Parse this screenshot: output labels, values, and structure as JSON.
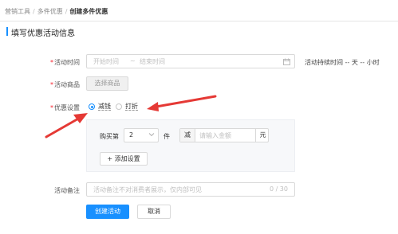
{
  "breadcrumb": {
    "items": [
      "营销工具",
      "多件优惠"
    ],
    "current": "创建多件优惠"
  },
  "section_title": "填写优惠活动信息",
  "form": {
    "time": {
      "label": "活动时间",
      "start_placeholder": "开始时间",
      "separator": "~",
      "end_placeholder": "结束时间",
      "duration_text": "活动持续时间 -- 天 -- 小时"
    },
    "product": {
      "label": "活动商品",
      "button": "选择商品"
    },
    "discount": {
      "label": "优惠设置",
      "options": [
        "减钱",
        "打折"
      ],
      "selected": "减钱",
      "rule": {
        "buy_label": "购买第",
        "quantity": "2",
        "unit": "件",
        "minus_label": "减",
        "amount_placeholder": "请输入金额",
        "currency": "元"
      },
      "add_button": "+ 添加设置"
    },
    "remark": {
      "label": "活动备注",
      "placeholder": "活动备注不对消费者展示，仅内部可见",
      "counter": "0 / 30"
    }
  },
  "actions": {
    "create": "创建活动",
    "cancel": "取消"
  },
  "colors": {
    "primary": "#1890ff",
    "required": "#f5222d",
    "annotation_arrow": "#e53935"
  }
}
